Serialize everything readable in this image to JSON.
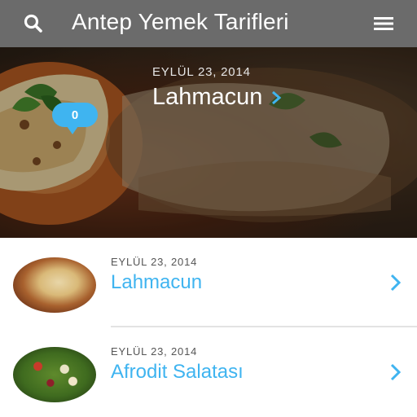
{
  "header": {
    "title": "Antep Yemek Tarifleri",
    "search_icon": "search-icon",
    "menu_icon": "hamburger-menu-icon",
    "background": "#6b6b6b"
  },
  "hero": {
    "badge_count": "0",
    "date": "EYLÜL 23, 2014",
    "title": "Lahmacun",
    "slide_count": 5,
    "active_slide": 1,
    "accent": "#3fb4f0"
  },
  "list": {
    "items": [
      {
        "date": "EYLÜL 23, 2014",
        "name": "Lahmacun"
      },
      {
        "date": "EYLÜL 23, 2014",
        "name": "Afrodit Salatası"
      }
    ]
  }
}
